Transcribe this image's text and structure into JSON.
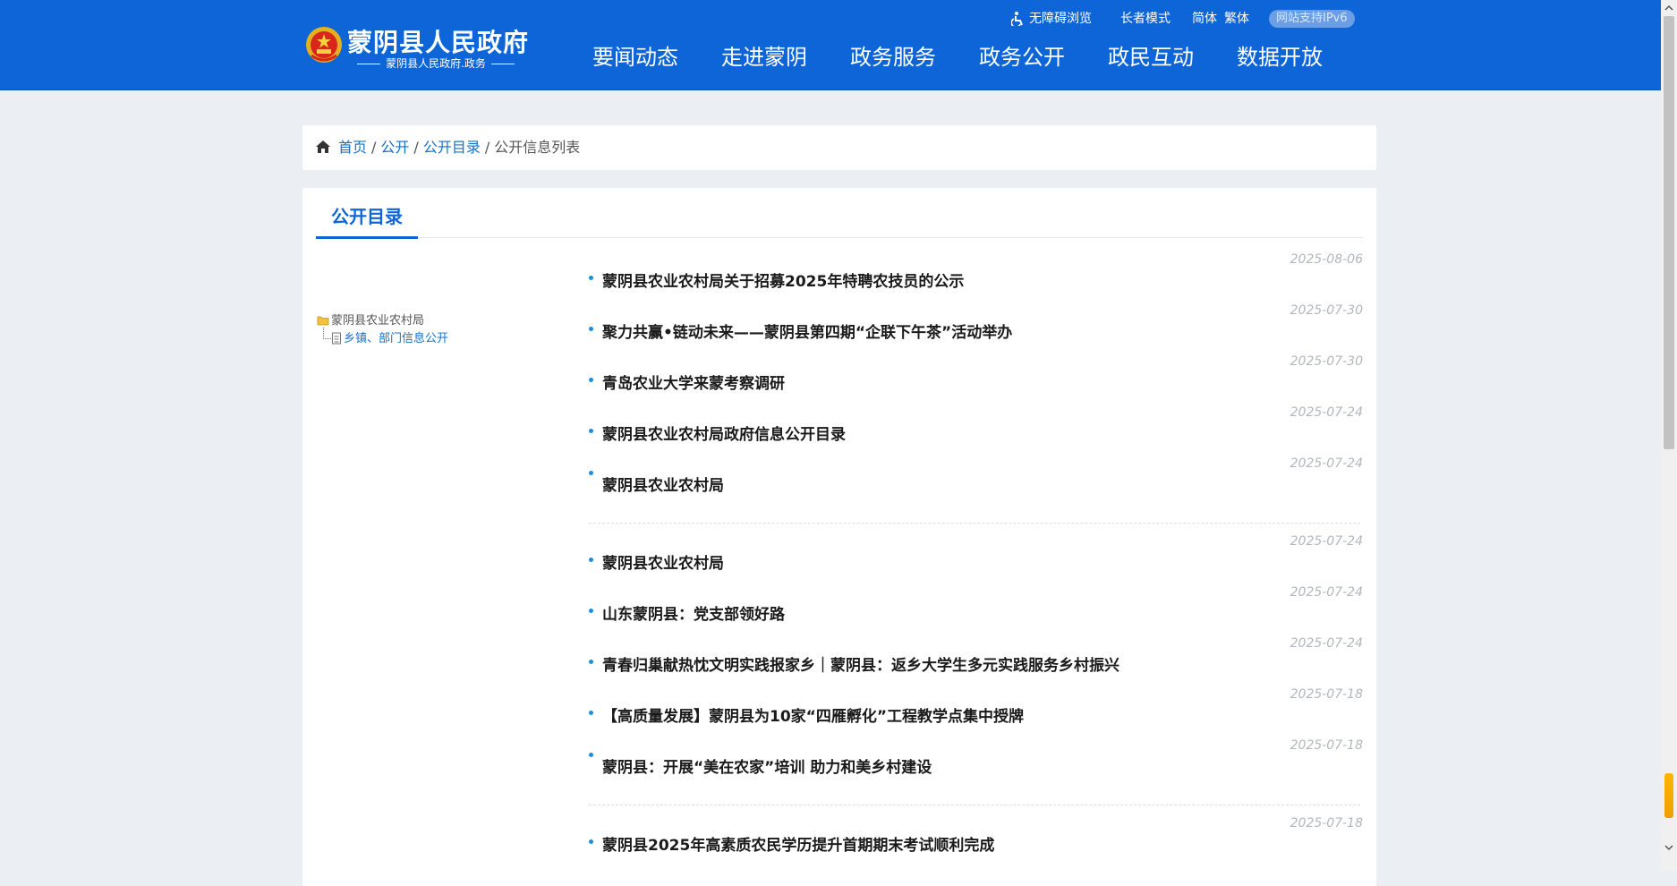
{
  "header": {
    "site_title": "蒙阴县人民政府",
    "site_subtitle": "蒙阴县人民政府.政务",
    "utilities": {
      "accessibility": "无障碍浏览",
      "elder_mode": "长者模式",
      "simplified": "简体",
      "traditional": "繁体",
      "ipv6": "网站支持IPv6"
    },
    "nav": [
      "要闻动态",
      "走进蒙阴",
      "政务服务",
      "政务公开",
      "政民互动",
      "数据开放"
    ]
  },
  "breadcrumb": {
    "home": "首页",
    "public": "公开",
    "catalog": "公开目录",
    "current": "公开信息列表",
    "separator": "/"
  },
  "main": {
    "tab_label": "公开目录",
    "tree": {
      "root": "蒙阴县农业农村局",
      "child": "乡镇、部门信息公开"
    },
    "items": [
      {
        "title": "蒙阴县农业农村局关于招募2025年特聘农技员的公示",
        "date": "2025-08-06"
      },
      {
        "title": "聚力共赢•链动未来——蒙阴县第四期“企联下午茶”活动举办",
        "date": "2025-07-30"
      },
      {
        "title": "青岛农业大学来蒙考察调研",
        "date": "2025-07-30"
      },
      {
        "title": "蒙阴县农业农村局政府信息公开目录",
        "date": "2025-07-24"
      },
      {
        "title": "蒙阴县农业农村局",
        "date": "2025-07-24"
      },
      {
        "title": "蒙阴县农业农村局",
        "date": "2025-07-24"
      },
      {
        "title": "山东蒙阴县：党支部领好路",
        "date": "2025-07-24"
      },
      {
        "title": "青春归巢献热忱文明实践报家乡｜蒙阴县：返乡大学生多元实践服务乡村振兴",
        "date": "2025-07-24"
      },
      {
        "title": "【高质量发展】蒙阴县为10家“四雁孵化”工程教学点集中授牌",
        "date": "2025-07-18"
      },
      {
        "title": "蒙阴县：开展“美在农家”培训 助力和美乡村建设",
        "date": "2025-07-18"
      },
      {
        "title": "蒙阴县2025年高素质农民学历提升首期期末考试顺利完成",
        "date": "2025-07-18"
      }
    ]
  },
  "colors": {
    "header_blue": "#0d65d8",
    "link_blue": "#1870c8",
    "bullet_blue": "#1a8fe0",
    "date_gray": "#b3b7bd",
    "page_bg": "#ebeff3"
  },
  "icons": [
    "national-emblem-icon",
    "accessibility-icon",
    "home-icon",
    "folder-icon",
    "document-icon",
    "scroll-up-icon",
    "scroll-down-icon"
  ]
}
